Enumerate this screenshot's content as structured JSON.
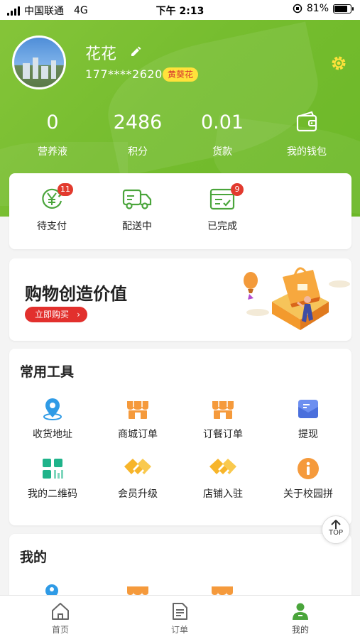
{
  "status_bar": {
    "carrier": "中国联通",
    "network": "4G",
    "time": "下午 2:13",
    "battery": "81%",
    "battery_level": 0.81
  },
  "profile": {
    "name": "花花",
    "phone": "177****2620",
    "level_badge": "黄葵花"
  },
  "stats": [
    {
      "value": "0",
      "label": "营养液"
    },
    {
      "value": "2486",
      "label": "积分"
    },
    {
      "value": "0.01",
      "label": "货款"
    },
    {
      "label": "我的钱包",
      "icon": "wallet-icon"
    }
  ],
  "orders": [
    {
      "label": "待支付",
      "count": "11",
      "icon": "yen-cycle-icon"
    },
    {
      "label": "配送中",
      "icon": "truck-icon"
    },
    {
      "label": "已完成",
      "count": "9",
      "icon": "checklist-icon"
    }
  ],
  "banner": {
    "title": "购物创造价值",
    "button": "立即购买",
    "button_chevron": "›"
  },
  "tools": {
    "title": "常用工具",
    "items": [
      {
        "label": "收货地址",
        "icon": "location-pin-icon"
      },
      {
        "label": "商城订单",
        "icon": "shop-icon"
      },
      {
        "label": "订餐订单",
        "icon": "shop-icon"
      },
      {
        "label": "提现",
        "icon": "envelope-icon"
      },
      {
        "label": "我的二维码",
        "icon": "qr-code-icon"
      },
      {
        "label": "会员升级",
        "icon": "handshake-icon"
      },
      {
        "label": "店铺入驻",
        "icon": "handshake-icon"
      },
      {
        "label": "关于校园拼",
        "icon": "info-icon"
      }
    ]
  },
  "mine": {
    "title": "我的"
  },
  "top_button": "TOP",
  "tabbar": [
    {
      "label": "首页",
      "icon": "home-icon"
    },
    {
      "label": "订单",
      "icon": "document-icon"
    },
    {
      "label": "我的",
      "icon": "user-icon",
      "active": true
    }
  ],
  "colors": {
    "brand_green": "#7bc133",
    "badge_red": "#e23a2e",
    "badge_yellow": "#ffe23b",
    "tool_orange": "#f59a3c",
    "tool_blue": "#2f9be6",
    "tool_teal": "#1fb38a",
    "tool_yellow": "#f7b52b"
  }
}
